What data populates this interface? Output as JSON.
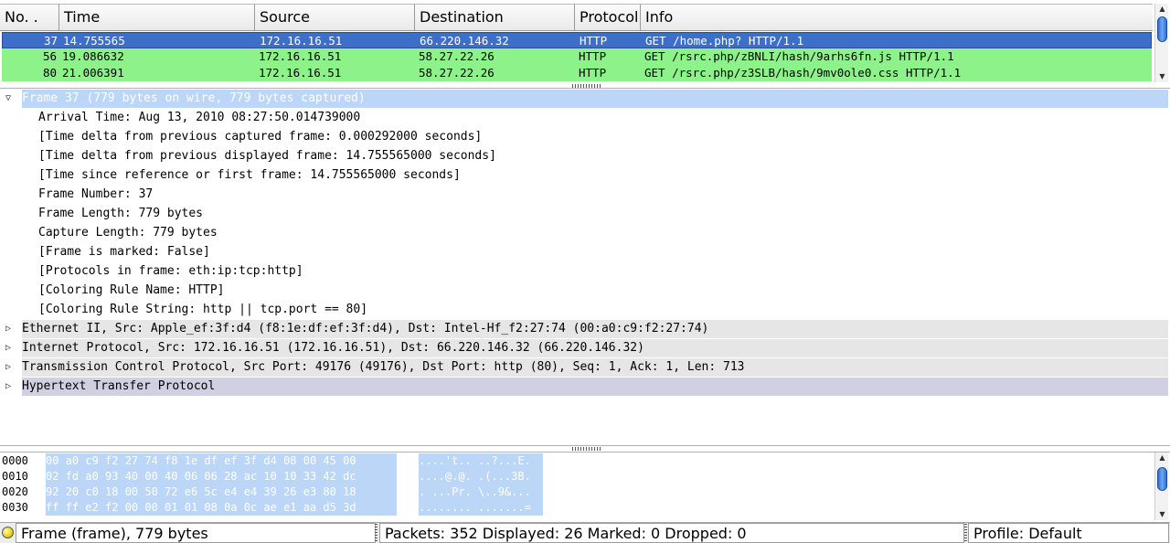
{
  "packet_list": {
    "columns": [
      "No. .",
      "Time",
      "Source",
      "Destination",
      "Protocol",
      "Info"
    ],
    "rows": [
      {
        "no": "37",
        "time": "14.755565",
        "source": "172.16.16.51",
        "destination": "66.220.146.32",
        "protocol": "HTTP",
        "info": "GET /home.php? HTTP/1.1"
      },
      {
        "no": "56",
        "time": "19.086632",
        "source": "172.16.16.51",
        "destination": "58.27.22.26",
        "protocol": "HTTP",
        "info": "GET /rsrc.php/zBNLI/hash/9arhs6fn.js HTTP/1.1"
      },
      {
        "no": "80",
        "time": "21.006391",
        "source": "172.16.16.51",
        "destination": "58.27.22.26",
        "protocol": "HTTP",
        "info": "GET /rsrc.php/z3SLB/hash/9mv0ole0.css HTTP/1.1"
      }
    ],
    "selected_row": 0
  },
  "details": {
    "frame": "Frame 37 (779 bytes on wire, 779 bytes captured)",
    "frame_fields": [
      "Arrival Time: Aug 13, 2010 08:27:50.014739000",
      "[Time delta from previous captured frame: 0.000292000 seconds]",
      "[Time delta from previous displayed frame: 14.755565000 seconds]",
      "[Time since reference or first frame: 14.755565000 seconds]",
      "Frame Number: 37",
      "Frame Length: 779 bytes",
      "Capture Length: 779 bytes",
      "[Frame is marked: False]",
      "[Protocols in frame: eth:ip:tcp:http]",
      "[Coloring Rule Name: HTTP]",
      "[Coloring Rule String: http || tcp.port == 80]"
    ],
    "ethernet": "Ethernet II, Src: Apple_ef:3f:d4 (f8:1e:df:ef:3f:d4), Dst: Intel-Hf_f2:27:74 (00:a0:c9:f2:27:74)",
    "ip": "Internet Protocol, Src: 172.16.16.51 (172.16.16.51), Dst: 66.220.146.32 (66.220.146.32)",
    "tcp": "Transmission Control Protocol, Src Port: 49176 (49176), Dst Port: http (80), Seq: 1, Ack: 1, Len: 713",
    "http": "Hypertext Transfer Protocol"
  },
  "hex": {
    "rows": [
      {
        "offset": "0000",
        "bytes": "00 a0 c9 f2 27 74 f8 1e  df ef 3f d4 08 00 45 00",
        "ascii": "....'t.. ..?...E."
      },
      {
        "offset": "0010",
        "bytes": "02 fd a0 93 40 00 40 06  06 28 ac 10 10 33 42 dc",
        "ascii": "....@.@. .(...3B."
      },
      {
        "offset": "0020",
        "bytes": "92 20 c0 18 00 50 72 e6  5c e4 e4 39 26 e3 80 18",
        "ascii": ". ...Pr. \\..9&..."
      },
      {
        "offset": "0030",
        "bytes": "ff ff e2 f2 00 00 01 01  08 0a 0c ae e1 aa d5 3d",
        "ascii": "........ .......="
      }
    ]
  },
  "status": {
    "frame_info": "Frame (frame), 779 bytes",
    "packets": "Packets: 352 Displayed: 26 Marked: 0 Dropped: 0",
    "profile": "Profile: Default"
  },
  "icons": {
    "collapse": "triangle-down",
    "expand": "triangle-right",
    "status_led": "yellow-circle"
  }
}
